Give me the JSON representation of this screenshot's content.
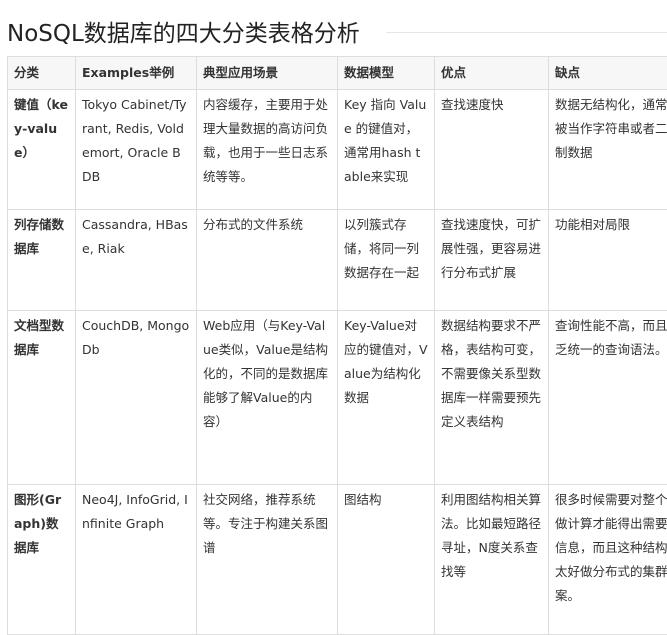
{
  "page": {
    "title": "NoSQL数据库的四大分类表格分析"
  },
  "table": {
    "headers": [
      "分类",
      "Examples举例",
      "典型应用场景",
      "数据模型",
      "优点",
      "缺点"
    ],
    "rows": [
      {
        "category": "键值（key-value）",
        "examples": "Tokyo Cabinet/Tyrant, Redis, Voldemort, Oracle BDB",
        "scenario": "内容缓存，主要用于处理大量数据的高访问负载，也用于一些日志系统等等。",
        "model": "Key 指向 Value 的键值对，通常用hash table来实现",
        "pros": "查找速度快",
        "cons": "数据无结构化，通常只被当作字符串或者二进制数据"
      },
      {
        "category": "列存储数据库",
        "examples": "Cassandra, HBase, Riak",
        "scenario": "分布式的文件系统",
        "model": "以列簇式存储，将同一列数据存在一起",
        "pros": "查找速度快，可扩展性强，更容易进行分布式扩展",
        "cons": "功能相对局限"
      },
      {
        "category": "文档型数据库",
        "examples": "CouchDB, MongoDb",
        "scenario": "Web应用（与Key-Value类似，Value是结构化的，不同的是数据库能够了解Value的内容）",
        "model": "Key-Value对应的键值对，Value为结构化数据",
        "pros": "数据结构要求不严格，表结构可变，不需要像关系型数据库一样需要预先定义表结构",
        "cons": "查询性能不高，而且缺乏统一的查询语法。"
      },
      {
        "category": "图形(Graph)数据库",
        "examples": "Neo4J, InfoGrid, Infinite Graph",
        "scenario": "社交网络，推荐系统等。专注于构建关系图谱",
        "model": "图结构",
        "pros": "利用图结构相关算法。比如最短路径寻址，N度关系查找等",
        "cons": "很多时候需要对整个图做计算才能得出需要的信息，而且这种结构不太好做分布式的集群方案。"
      }
    ]
  }
}
